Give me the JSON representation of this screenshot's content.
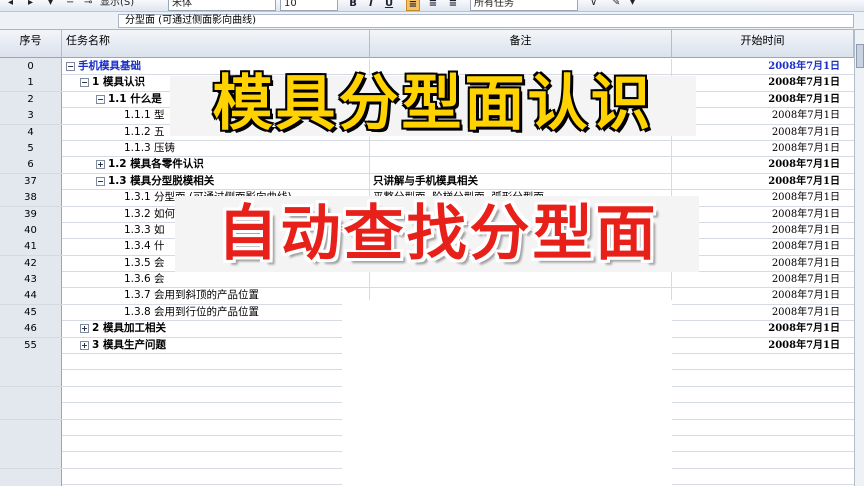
{
  "toolbar": {
    "show_label": "显示(S)",
    "font_name": "宋体",
    "font_size": "10",
    "bold_btn": "B",
    "italic_btn": "I",
    "underline_btn": "U",
    "filter_value": "所有任务"
  },
  "entry_bar": {
    "value": "分型面 (可通过侧面影向曲线)"
  },
  "columns": {
    "seq": "序号",
    "name": "任务名称",
    "note": "备注",
    "start": "开始时间"
  },
  "rows": [
    {
      "seq": "0",
      "name": "手机模具基础",
      "note": "",
      "start": "2008年7月1日"
    },
    {
      "seq": "1",
      "name": "1 模具认识",
      "note": "",
      "start": "2008年7月1日"
    },
    {
      "seq": "2",
      "name": "1.1 什么是",
      "note": "",
      "start": "2008年7月1日"
    },
    {
      "seq": "3",
      "name": "1.1.1 型",
      "note": "",
      "start": "2008年7月1日"
    },
    {
      "seq": "4",
      "name": "1.1.2 五",
      "note": "",
      "start": "2008年7月1日"
    },
    {
      "seq": "5",
      "name": "1.1.3 压铸",
      "note": "",
      "start": "2008年7月1日"
    },
    {
      "seq": "6",
      "name": "1.2 模具各零件认识",
      "note": "",
      "start": "2008年7月1日"
    },
    {
      "seq": "37",
      "name": "1.3 模具分型脱模相关",
      "note": "只讲解与手机模具相关",
      "start": "2008年7月1日"
    },
    {
      "seq": "38",
      "name": "1.3.1 分型面 (可通过侧面影向曲线)",
      "note": "平整分型面, 阶梯分型面, 弧形分型面",
      "start": "2008年7月1日"
    },
    {
      "seq": "39",
      "name": "1.3.2 如何",
      "note": "",
      "start": "2008年7月1日"
    },
    {
      "seq": "40",
      "name": "1.3.3 如",
      "note": "",
      "start": "2008年7月1日"
    },
    {
      "seq": "41",
      "name": "1.3.4 什",
      "note": "",
      "start": "2008年7月1日"
    },
    {
      "seq": "42",
      "name": "1.3.5 会",
      "note": "",
      "start": "2008年7月1日"
    },
    {
      "seq": "43",
      "name": "1.3.6 会",
      "note": "",
      "start": "2008年7月1日"
    },
    {
      "seq": "44",
      "name": "1.3.7 会用到斜顶的产品位置",
      "note": "",
      "start": "2008年7月1日"
    },
    {
      "seq": "45",
      "name": "1.3.8 会用到行位的产品位置",
      "note": "",
      "start": "2008年7月1日"
    },
    {
      "seq": "46",
      "name": "2 模具加工相关",
      "note": "",
      "start": "2008年7月1日"
    },
    {
      "seq": "55",
      "name": "3 模具生产问题",
      "note": "",
      "start": "2008年7月1日"
    },
    {
      "seq": "",
      "name": "",
      "note": "",
      "start": ""
    },
    {
      "seq": "",
      "name": "",
      "note": "",
      "start": ""
    },
    {
      "seq": "",
      "name": "",
      "note": "",
      "start": ""
    },
    {
      "seq": "",
      "name": "",
      "note": "",
      "start": ""
    },
    {
      "seq": "",
      "name": "",
      "note": "",
      "start": ""
    },
    {
      "seq": "",
      "name": "",
      "note": "",
      "start": ""
    },
    {
      "seq": "",
      "name": "",
      "note": "",
      "start": ""
    },
    {
      "seq": "",
      "name": "",
      "note": "",
      "start": ""
    }
  ],
  "overlay": {
    "title_line1": "模具分型面认识",
    "title_line2": "自动查找分型面"
  },
  "colors": {
    "title1": "#ffd200",
    "title2": "#e8201a",
    "root_task": "#1a2fc8"
  }
}
